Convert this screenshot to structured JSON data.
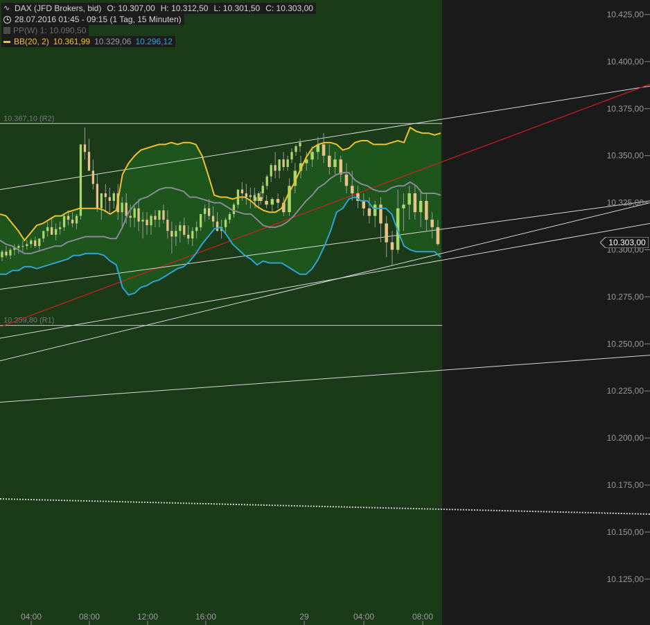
{
  "header": {
    "instrument": "DAX (JFD Brokers, bid)",
    "open": "O: 10.307,00",
    "high": "H: 10.312,50",
    "low": "L: 10.301,50",
    "close": "C: 10.303,00",
    "timeframe": "28.07.2016 01:45 - 09:15 (1 Tag, 15 Minuten)",
    "pivot_label": "PP(W)  1: 10.090,50",
    "bb_label": "BB(20, 2)",
    "bb_upper": "10.361,99",
    "bb_middle": "10.329,06",
    "bb_lower": "10.296,12"
  },
  "price_tag": "10.303,00",
  "colors": {
    "plot_background": "#1a3a18",
    "future_background": "#1a1a1a",
    "band_fill": "#1e5a1e",
    "bb_upper": "#f2c12e",
    "bb_middle": "#8a8a96",
    "bb_lower": "#2fa3d4",
    "trendline_red": "#d42020",
    "trendline_white": "#d8d8d8",
    "candle_up": "#a8d868",
    "candle_down": "#e8c28a"
  },
  "chart_data": {
    "type": "candlestick",
    "y_ticks": [
      "10.425,00",
      "10.400,00",
      "10.375,00",
      "10.350,00",
      "10.325,00",
      "10.300,00",
      "10.275,00",
      "10.250,00",
      "10.225,00",
      "10.200,00",
      "10.175,00",
      "10.150,00",
      "10.125,00"
    ],
    "x_ticks": [
      "04:00",
      "08:00",
      "12:00",
      "16:00",
      "29",
      "04:00",
      "08:00"
    ],
    "ylim": [
      10110,
      10432
    ],
    "resistance": {
      "label": "10.367,10 (R2)",
      "value": 10367.1
    },
    "support": {
      "label": "10.259,80 (R1)",
      "value": 10259.8
    },
    "pivot_weekly": 10090.5,
    "bollinger": {
      "upper": [
        10319,
        10318,
        10314,
        10310,
        10305,
        10309,
        10313,
        10314,
        10316,
        10318,
        10318,
        10320,
        10321,
        10322,
        10322,
        10322,
        10322,
        10321,
        10319,
        10321,
        10340,
        10346,
        10350,
        10353,
        10354,
        10355,
        10356,
        10356,
        10357,
        10356,
        10357,
        10357,
        10356,
        10350,
        10340,
        10329,
        10328,
        10328,
        10327,
        10328,
        10328,
        10326,
        10323,
        10321,
        10320,
        10320,
        10322,
        10329,
        10335,
        10342,
        10349,
        10354,
        10356,
        10357,
        10357,
        10356,
        10353,
        10354,
        10357,
        10358,
        10358,
        10356,
        10356,
        10356,
        10357,
        10358,
        10357,
        10365,
        10363,
        10362,
        10362,
        10361,
        10362
      ],
      "middle": [
        10305,
        10303,
        10302,
        10300,
        10298,
        10298,
        10299,
        10300,
        10301,
        10302,
        10302,
        10304,
        10305,
        10306,
        10307,
        10307,
        10307,
        10307,
        10306,
        10306,
        10312,
        10320,
        10324,
        10327,
        10328,
        10330,
        10332,
        10333,
        10333,
        10332,
        10331,
        10328,
        10328,
        10327,
        10326,
        10325,
        10325,
        10323,
        10321,
        10320,
        10319,
        10319,
        10316,
        10313,
        10312,
        10312,
        10313,
        10315,
        10318,
        10322,
        10326,
        10329,
        10333,
        10335,
        10338,
        10340,
        10341,
        10341,
        10337,
        10335,
        10334,
        10332,
        10331,
        10331,
        10333,
        10334,
        10334,
        10336,
        10334,
        10330,
        10330,
        10330,
        10329
      ],
      "lower": [
        10287,
        10287,
        10289,
        10289,
        10291,
        10291,
        10290,
        10291,
        10292,
        10293,
        10294,
        10295,
        10297,
        10297,
        10298,
        10298,
        10298,
        10297,
        10294,
        10292,
        10280,
        10276,
        10277,
        10280,
        10281,
        10283,
        10284,
        10286,
        10288,
        10290,
        10291,
        10294,
        10298,
        10303,
        10307,
        10311,
        10312,
        10308,
        10303,
        10300,
        10297,
        10295,
        10292,
        10294,
        10293,
        10293,
        10293,
        10291,
        10289,
        10287,
        10287,
        10290,
        10295,
        10302,
        10310,
        10320,
        10322,
        10327,
        10328,
        10326,
        10326,
        10322,
        10322,
        10322,
        10319,
        10310,
        10302,
        10300,
        10299,
        10299,
        10299,
        10299,
        10296
      ],
      "x_start": "2016-07-28 01:45",
      "x_end": "2016-07-29 09:15",
      "interval_min": 15
    },
    "candles": {
      "x_start": "2016-07-28 01:45",
      "interval_min": 15,
      "open": [
        10296,
        10299,
        10297,
        10300,
        10301,
        10302,
        10302,
        10303,
        10305,
        10302,
        10306,
        10310,
        10312,
        10308,
        10311,
        10312,
        10318,
        10316,
        10314,
        10318,
        10356,
        10352,
        10342,
        10335,
        10322,
        10330,
        10328,
        10326,
        10330,
        10320,
        10325,
        10318,
        10317,
        10322,
        10315,
        10316,
        10313,
        10318,
        10316,
        10321,
        10316,
        10310,
        10307,
        10310,
        10313,
        10308,
        10306,
        10310,
        10312,
        10319,
        10322,
        10318,
        10315,
        10310,
        10312,
        10316,
        10319,
        10324,
        10332,
        10330,
        10328,
        10329,
        10326,
        10330,
        10334,
        10339,
        10345,
        10342,
        10348,
        10344,
        10348,
        10352,
        10355
      ],
      "high": [
        10300,
        10302,
        10301,
        10303,
        10303,
        10305,
        10305,
        10306,
        10307,
        10306,
        10310,
        10315,
        10317,
        10314,
        10315,
        10319,
        10321,
        10320,
        10319,
        10340,
        10365,
        10359,
        10348,
        10340,
        10330,
        10335,
        10333,
        10331,
        10335,
        10328,
        10330,
        10324,
        10323,
        10327,
        10320,
        10320,
        10319,
        10321,
        10321,
        10324,
        10321,
        10315,
        10313,
        10315,
        10317,
        10313,
        10312,
        10315,
        10318,
        10324,
        10327,
        10323,
        10320,
        10316,
        10317,
        10320,
        10325,
        10332,
        10336,
        10335,
        10333,
        10333,
        10331,
        10336,
        10340,
        10346,
        10352,
        10347,
        10352,
        10350,
        10354,
        10356,
        10359
      ],
      "low": [
        10294,
        10296,
        10295,
        10297,
        10298,
        10299,
        10300,
        10301,
        10301,
        10300,
        10304,
        10307,
        10309,
        10305,
        10308,
        10310,
        10313,
        10312,
        10311,
        10316,
        10348,
        10342,
        10332,
        10320,
        10316,
        10320,
        10320,
        10322,
        10316,
        10312,
        10314,
        10312,
        10312,
        10310,
        10306,
        10308,
        10308,
        10312,
        10312,
        10314,
        10306,
        10298,
        10302,
        10304,
        10307,
        10303,
        10302,
        10306,
        10310,
        10315,
        10316,
        10312,
        10310,
        10306,
        10308,
        10314,
        10317,
        10322,
        10326,
        10324,
        10322,
        10324,
        10322,
        10327,
        10332,
        10336,
        10338,
        10338,
        10342,
        10342,
        10346,
        10350,
        10352
      ],
      "close": [
        10299,
        10297,
        10300,
        10301,
        10302,
        10302,
        10303,
        10305,
        10302,
        10306,
        10310,
        10312,
        10308,
        10311,
        10312,
        10318,
        10316,
        10314,
        10318,
        10356,
        10352,
        10342,
        10335,
        10322,
        10330,
        10328,
        10326,
        10330,
        10320,
        10325,
        10318,
        10317,
        10322,
        10315,
        10316,
        10313,
        10318,
        10316,
        10321,
        10316,
        10310,
        10307,
        10310,
        10313,
        10308,
        10306,
        10310,
        10312,
        10319,
        10322,
        10318,
        10315,
        10310,
        10312,
        10316,
        10319,
        10324,
        10332,
        10330,
        10328,
        10329,
        10326,
        10330,
        10334,
        10339,
        10345,
        10342,
        10348,
        10344,
        10348,
        10352,
        10355,
        10357
      ]
    },
    "candles_day2": {
      "x_start": "2016-07-29 02:00",
      "interval_min": 15,
      "open": [
        10326,
        10328,
        10326,
        10324,
        10327,
        10325,
        10320,
        10334,
        10342,
        10346,
        10348,
        10352,
        10356,
        10350,
        10344,
        10348,
        10340,
        10334,
        10330,
        10326,
        10322,
        10318,
        10324,
        10314,
        10304,
        10300,
        10322,
        10324,
        10330,
        10320,
        10326,
        10316,
        10312
      ],
      "high": [
        10330,
        10331,
        10329,
        10328,
        10330,
        10328,
        10338,
        10346,
        10350,
        10352,
        10355,
        10360,
        10362,
        10356,
        10352,
        10350,
        10346,
        10342,
        10334,
        10330,
        10328,
        10326,
        10328,
        10318,
        10310,
        10332,
        10330,
        10334,
        10334,
        10331,
        10330,
        10320,
        10316
      ],
      "low": [
        10322,
        10324,
        10322,
        10320,
        10322,
        10318,
        10318,
        10330,
        10338,
        10342,
        10344,
        10348,
        10346,
        10340,
        10340,
        10336,
        10330,
        10326,
        10322,
        10318,
        10314,
        10312,
        10304,
        10296,
        10292,
        10298,
        10310,
        10316,
        10316,
        10312,
        10310,
        10306,
        10302
      ],
      "close": [
        10328,
        10326,
        10324,
        10327,
        10325,
        10320,
        10334,
        10342,
        10346,
        10348,
        10352,
        10356,
        10350,
        10344,
        10348,
        10340,
        10334,
        10330,
        10326,
        10322,
        10318,
        10324,
        10314,
        10304,
        10300,
        10322,
        10324,
        10330,
        10320,
        10326,
        10316,
        10312,
        10303
      ]
    }
  }
}
